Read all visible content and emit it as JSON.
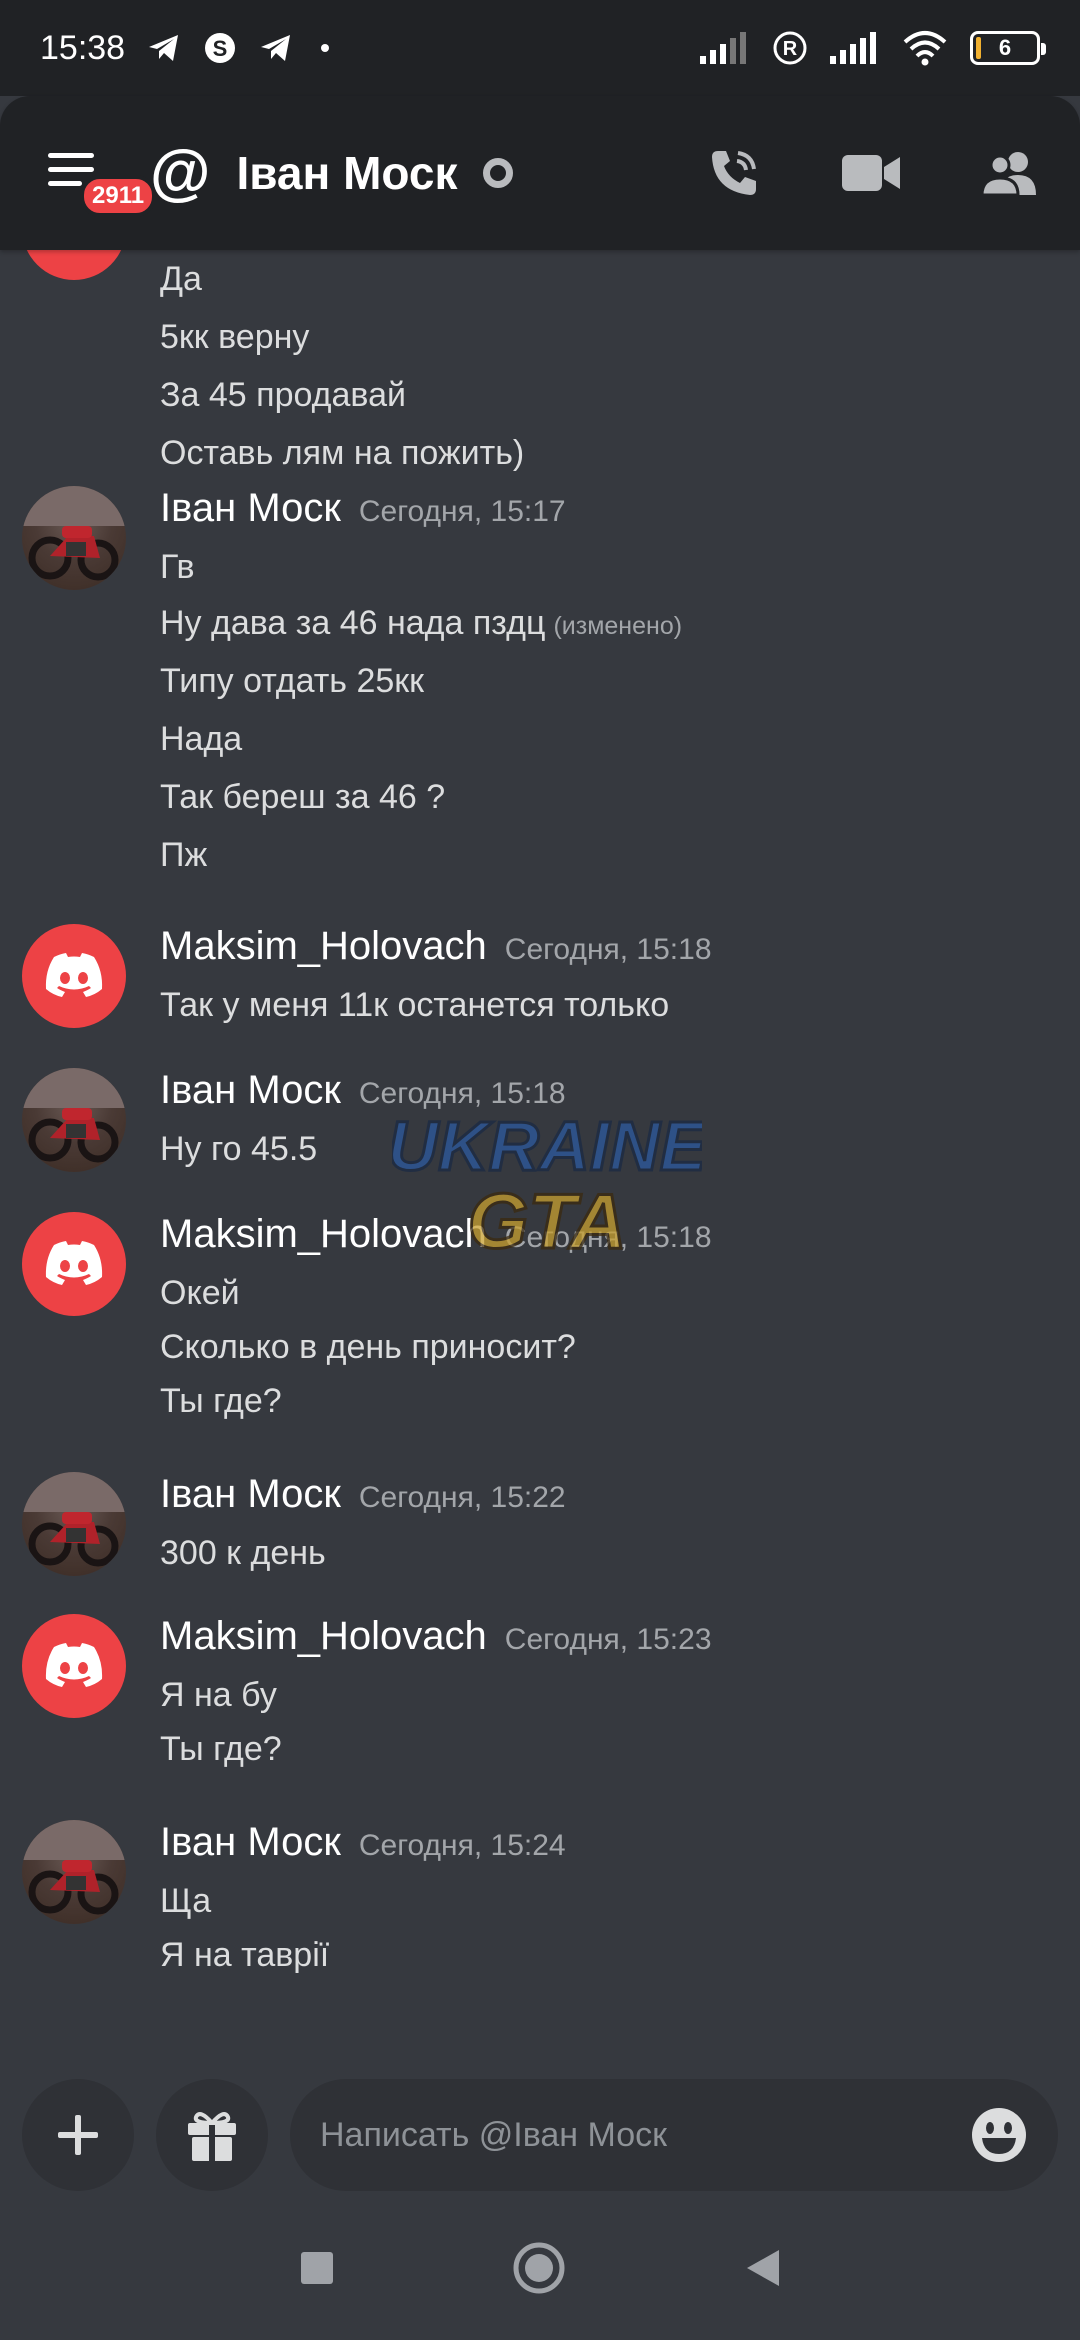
{
  "status_bar": {
    "time": "15:38",
    "battery_level": "6"
  },
  "header": {
    "title": "Іван Моск",
    "badge_count": "2911"
  },
  "messages": [
    {
      "lines": [
        "Да",
        "5кк верну",
        "За 45 продавай",
        "Оставь лям на пожить)"
      ]
    },
    {
      "username": "Іван Моск",
      "timestamp": "Сегодня, 15:17",
      "lines": [
        "Гв",
        "Ну дава за 46 нада пздц",
        "Типу отдать 25кк",
        "Нада",
        "Так береш за 46 ?",
        "Пж"
      ],
      "edited_label": "(изменено)"
    },
    {
      "username": "Maksim_Holovach",
      "timestamp": "Сегодня, 15:18",
      "lines": [
        "Так у меня 11к останется только"
      ]
    },
    {
      "username": "Іван Моск",
      "timestamp": "Сегодня, 15:18",
      "lines": [
        "Ну го 45.5"
      ]
    },
    {
      "username": "Maksim_Holovach",
      "timestamp": "Сегодня, 15:18",
      "lines": [
        "Окей",
        "Сколько в день приносит?",
        "Ты где?"
      ]
    },
    {
      "username": "Іван Моск",
      "timestamp": "Сегодня, 15:22",
      "lines": [
        "300 к день"
      ]
    },
    {
      "username": "Maksim_Holovach",
      "timestamp": "Сегодня, 15:23",
      "lines": [
        "Я на бу",
        "Ты где?"
      ]
    },
    {
      "username": "Іван Моск",
      "timestamp": "Сегодня, 15:24",
      "lines": [
        "Ща",
        "Я на таврії"
      ]
    }
  ],
  "watermark": {
    "line1": "UKRAINE",
    "line2": "GTA"
  },
  "composer": {
    "placeholder": "Написать @Іван Моск"
  },
  "colors": {
    "brand_red": "#ed4245",
    "background": "#36393f",
    "header_bg": "#202225"
  }
}
